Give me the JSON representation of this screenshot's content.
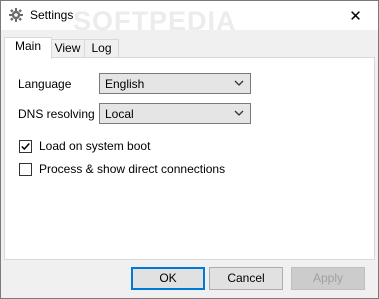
{
  "window": {
    "title": "Settings",
    "watermark": "SOFTPEDIA"
  },
  "tabs": [
    {
      "label": "Main",
      "active": true
    },
    {
      "label": "View",
      "active": false
    },
    {
      "label": "Log",
      "active": false
    }
  ],
  "main": {
    "language": {
      "label": "Language",
      "value": "English"
    },
    "dns": {
      "label": "DNS resolving",
      "value": "Local"
    },
    "options": [
      {
        "label": "Load on system boot",
        "checked": true
      },
      {
        "label": "Process & show direct connections",
        "checked": false
      }
    ]
  },
  "buttons": {
    "ok": "OK",
    "cancel": "Cancel",
    "apply": "Apply"
  },
  "icons": {
    "app": "gear-icon",
    "close": "close-icon",
    "dropdown": "chevron-down-icon",
    "check": "check-icon"
  }
}
